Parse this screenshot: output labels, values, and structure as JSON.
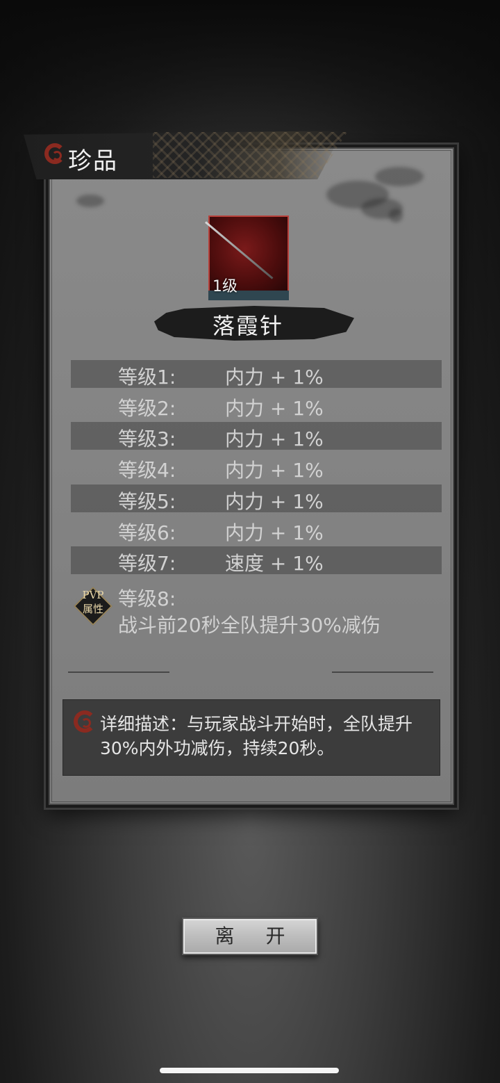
{
  "header": {
    "title": "珍品"
  },
  "item": {
    "level_badge": "1级",
    "name": "落霞针"
  },
  "stats": [
    {
      "label": "等级1:",
      "value": "内力 + 1%"
    },
    {
      "label": "等级2:",
      "value": "内力 + 1%"
    },
    {
      "label": "等级3:",
      "value": "内力 + 1%"
    },
    {
      "label": "等级4:",
      "value": "内力 + 1%"
    },
    {
      "label": "等级5:",
      "value": "内力 + 1%"
    },
    {
      "label": "等级6:",
      "value": "内力 + 1%"
    },
    {
      "label": "等级7:",
      "value": "速度 + 1%"
    }
  ],
  "pvp": {
    "badge_line1": "PVP",
    "badge_line2": "属性",
    "label": "等级8:",
    "effect": "战斗前20秒全队提升30%减伤"
  },
  "description": {
    "text": "详细描述：与玩家战斗开始时，全队提升30%内外功减伤，持续20秒。"
  },
  "buttons": {
    "leave": "离 开"
  },
  "colors": {
    "accent_red": "#8b2a20",
    "panel_bg": "#858585",
    "text_light": "#d2d2d2"
  }
}
